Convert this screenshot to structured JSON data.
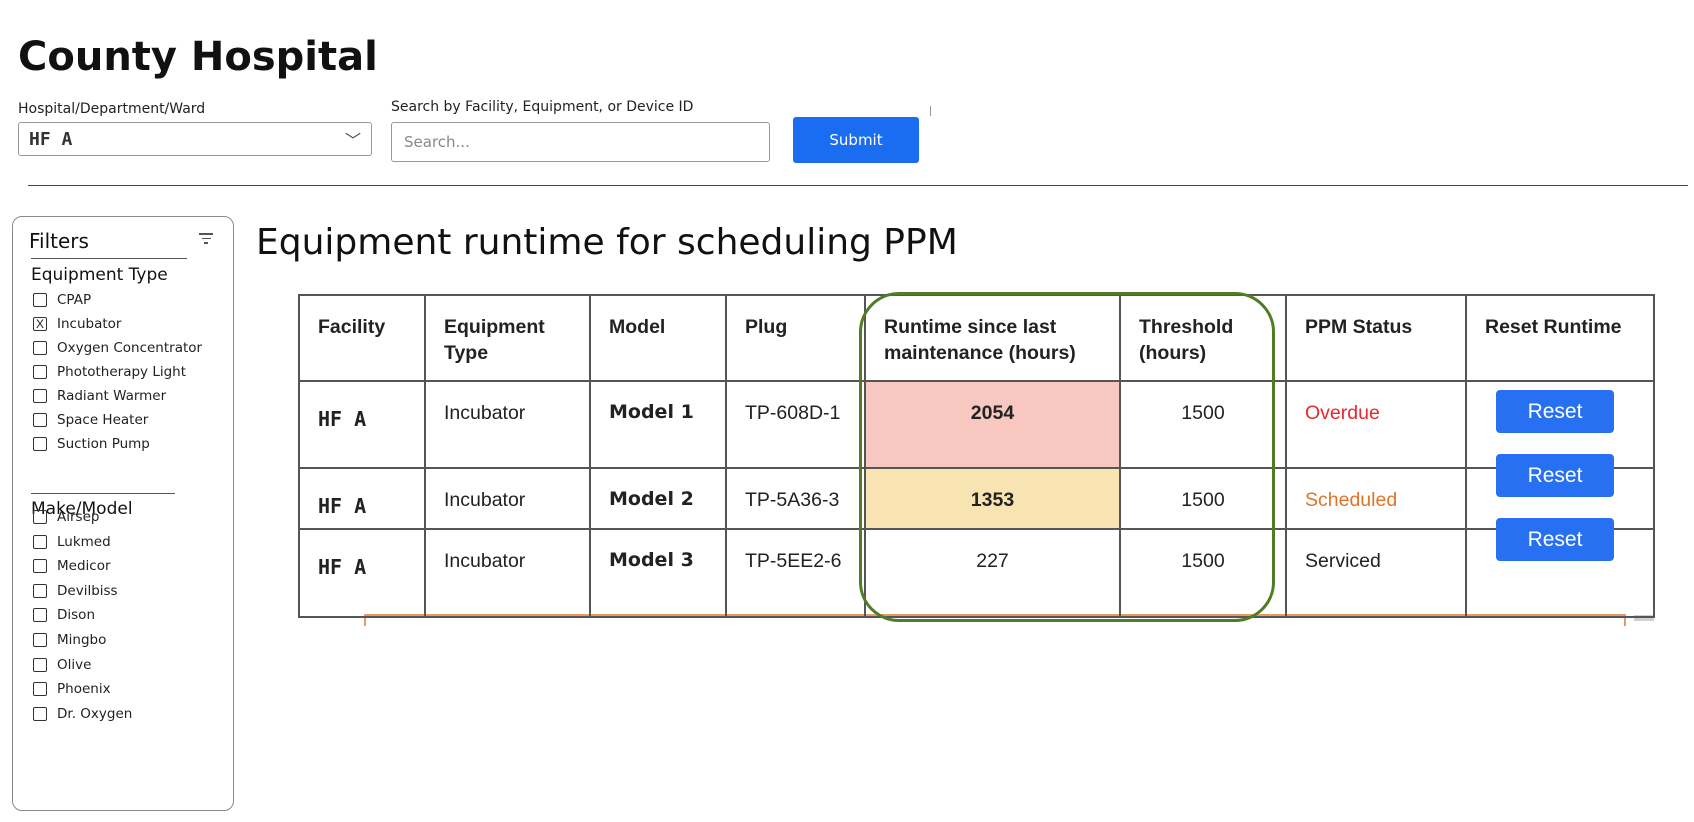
{
  "app": {
    "title": "County Hospital"
  },
  "header": {
    "location_label": "Hospital/Department/Ward",
    "location_value": "HF A",
    "search_label": "Search by Facility, Equipment, or Device ID",
    "search_placeholder": "Search...",
    "submit_label": "Submit"
  },
  "filters": {
    "title": "Filters",
    "equipment_type": {
      "title": "Equipment Type",
      "items": [
        {
          "label": "CPAP",
          "checked": false
        },
        {
          "label": "Incubator",
          "checked": true
        },
        {
          "label": "Oxygen Concentrator",
          "checked": false
        },
        {
          "label": "Phototherapy Light",
          "checked": false
        },
        {
          "label": "Radiant Warmer",
          "checked": false
        },
        {
          "label": "Space Heater",
          "checked": false
        },
        {
          "label": "Suction Pump",
          "checked": false
        }
      ]
    },
    "make_model": {
      "title": "Make/Model",
      "items": [
        {
          "label": "Airsep",
          "checked": false
        },
        {
          "label": "Lukmed",
          "checked": false
        },
        {
          "label": "Medicor",
          "checked": false
        },
        {
          "label": "Devilbiss",
          "checked": false
        },
        {
          "label": "Dison",
          "checked": false
        },
        {
          "label": "Mingbo",
          "checked": false
        },
        {
          "label": "Olive",
          "checked": false
        },
        {
          "label": "Phoenix",
          "checked": false
        },
        {
          "label": "Dr. Oxygen",
          "checked": false
        }
      ]
    },
    "checked_mark": "X"
  },
  "main": {
    "title": "Equipment runtime for scheduling PPM",
    "table": {
      "headers": [
        "Facility",
        "Equipment Type",
        "Model",
        "Plug",
        "Runtime since last maintenance (hours)",
        "Threshold (hours)",
        "PPM Status",
        "Reset Runtime"
      ],
      "rows": [
        {
          "facility": "HF A",
          "equipment_type": "Incubator",
          "model": "Model 1",
          "plug": "TP-608D-1",
          "runtime": "2054",
          "threshold": "1500",
          "status": "Overdue"
        },
        {
          "facility": "HF A",
          "equipment_type": "Incubator",
          "model": "Model 2",
          "plug": "TP-5A36-3",
          "runtime": "1353",
          "threshold": "1500",
          "status": "Scheduled"
        },
        {
          "facility": "HF A",
          "equipment_type": "Incubator",
          "model": "Model 3",
          "plug": "TP-5EE2-6",
          "runtime": "227",
          "threshold": "1500",
          "status": "Serviced"
        }
      ],
      "reset_labels": [
        "Reset",
        "Reset",
        "Reset"
      ]
    }
  },
  "colors": {
    "primary": "#1a6cf0",
    "overdue_text": "#e8262d",
    "scheduled_text": "#e0732a",
    "overdue_fill": "#f8c8c0",
    "scheduled_fill": "#f8e3b2",
    "highlight_ring": "#4f7d25"
  },
  "icons": {
    "filter": "filter-icon",
    "dropdown": "chevron-down-icon"
  }
}
